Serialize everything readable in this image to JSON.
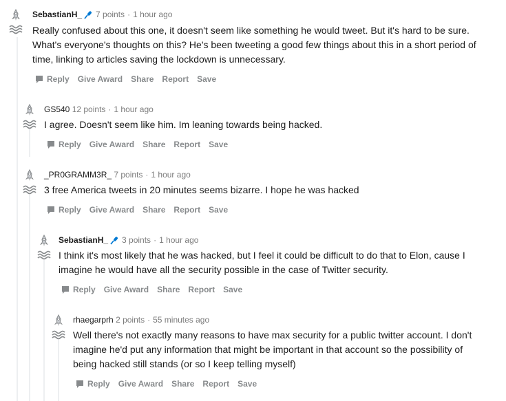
{
  "comments": [
    {
      "author": "SebastianH_",
      "points": "7 points",
      "time": "1 hour ago",
      "body": "Really confused about this one, it doesn't seem like something he would tweet. But it's hard to be sure. What's everyone's thoughts on this? He's been tweeting a good few things about this in a short period of time, linking to articles saving the lockdown is unnecessary."
    },
    {
      "author": "GS540",
      "points": "12 points",
      "time": "1 hour ago",
      "body": "I agree. Doesn't seem like him. Im leaning towards being hacked."
    },
    {
      "author": "_PR0GRAMM3R_",
      "points": "7 points",
      "time": "1 hour ago",
      "body": "3 free America tweets in 20 minutes seems bizarre. I hope he was hacked"
    },
    {
      "author": "SebastianH_",
      "points": "3 points",
      "time": "1 hour ago",
      "body": "I think it's most likely that he was hacked, but I feel it could be difficult to do that to Elon, cause I imagine he would have all the security possible in the case of Twitter security."
    },
    {
      "author": "rhaegarprh",
      "points": "2 points",
      "time": "55 minutes ago",
      "body": "Well there's not exactly many reasons to have max security for a public twitter account. I don't imagine he'd put any information that might be important in that account so the possibility of being hacked still stands (or so I keep telling myself)"
    }
  ],
  "actions": {
    "reply": "Reply",
    "give_award": "Give Award",
    "share": "Share",
    "report": "Report",
    "save": "Save"
  },
  "separator": "·",
  "colors": {
    "text": "#1c1c1c",
    "meta": "#7c7c7c",
    "action": "#878a8c",
    "thread_line": "#edeff1",
    "mic_badge": "#0079d3"
  }
}
